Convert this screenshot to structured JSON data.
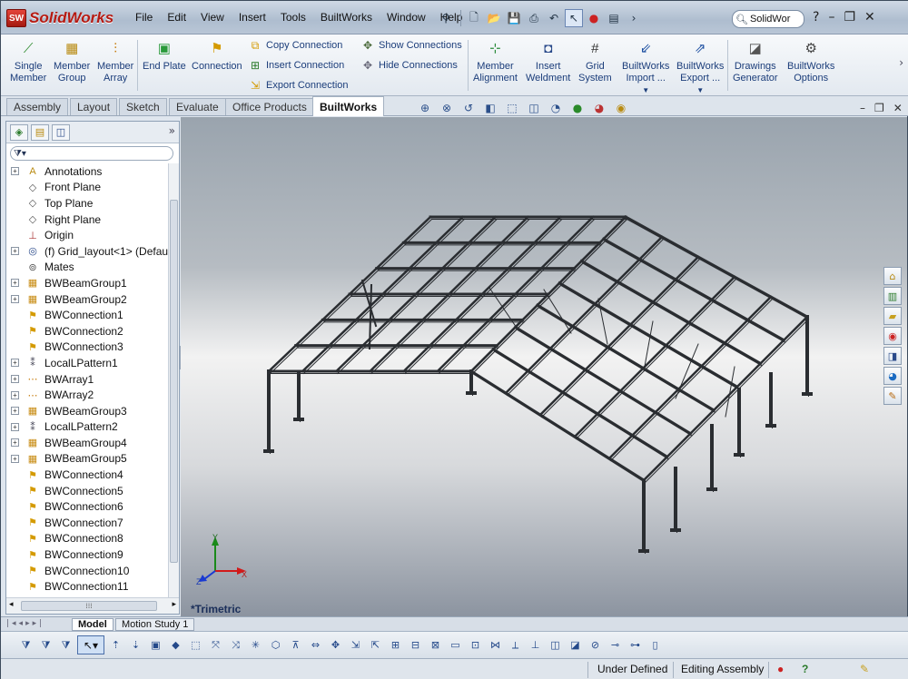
{
  "app": {
    "logo_badge": "SW",
    "name": "SolidWorks"
  },
  "menu": [
    "File",
    "Edit",
    "View",
    "Insert",
    "Tools",
    "BuiltWorks",
    "Window",
    "Help"
  ],
  "search": {
    "value": "SolidWor"
  },
  "ribbon": {
    "single_member": [
      "Single",
      "Member"
    ],
    "member_group": [
      "Member",
      "Group"
    ],
    "member_array": [
      "Member",
      "Array"
    ],
    "end_plate": "End Plate",
    "connection": "Connection",
    "copy_connection": "Copy Connection",
    "insert_connection": "Insert Connection",
    "export_connection": "Export Connection",
    "show_connections": "Show Connections",
    "hide_connections": "Hide Connections",
    "member_alignment": [
      "Member",
      "Alignment"
    ],
    "insert_weldment": [
      "Insert",
      "Weldment"
    ],
    "grid_system": [
      "Grid",
      "System"
    ],
    "bw_import": [
      "BuiltWorks",
      "Import ..."
    ],
    "bw_export": [
      "BuiltWorks",
      "Export ..."
    ],
    "drawings_generator": [
      "Drawings",
      "Generator"
    ],
    "bw_options": [
      "BuiltWorks",
      "Options"
    ]
  },
  "tabs": [
    "Assembly",
    "Layout",
    "Sketch",
    "Evaluate",
    "Office Products",
    "BuiltWorks"
  ],
  "active_tab": "BuiltWorks",
  "tree": [
    {
      "label": "Annotations",
      "icon": "annotations-icon",
      "expand": true
    },
    {
      "label": "Front Plane",
      "icon": "plane-icon",
      "expand": false
    },
    {
      "label": "Top Plane",
      "icon": "plane-icon",
      "expand": false
    },
    {
      "label": "Right Plane",
      "icon": "plane-icon",
      "expand": false
    },
    {
      "label": "Origin",
      "icon": "origin-icon",
      "expand": false
    },
    {
      "label": "(f) Grid_layout<1> (Defaul",
      "icon": "part-icon",
      "expand": true
    },
    {
      "label": "Mates",
      "icon": "mates-icon",
      "expand": false
    },
    {
      "label": "BWBeamGroup1",
      "icon": "beam-group-icon",
      "expand": true
    },
    {
      "label": "BWBeamGroup2",
      "icon": "beam-group-icon",
      "expand": true
    },
    {
      "label": "BWConnection1",
      "icon": "connection-icon",
      "expand": false
    },
    {
      "label": "BWConnection2",
      "icon": "connection-icon",
      "expand": false
    },
    {
      "label": "BWConnection3",
      "icon": "connection-icon",
      "expand": false
    },
    {
      "label": "LocalLPattern1",
      "icon": "pattern-icon",
      "expand": true
    },
    {
      "label": "BWArray1",
      "icon": "array-icon",
      "expand": true
    },
    {
      "label": "BWArray2",
      "icon": "array-icon",
      "expand": true
    },
    {
      "label": "BWBeamGroup3",
      "icon": "beam-group-icon",
      "expand": true
    },
    {
      "label": "LocalLPattern2",
      "icon": "pattern-icon",
      "expand": true
    },
    {
      "label": "BWBeamGroup4",
      "icon": "beam-group-icon",
      "expand": true
    },
    {
      "label": "BWBeamGroup5",
      "icon": "beam-group-icon",
      "expand": true
    },
    {
      "label": "BWConnection4",
      "icon": "connection-icon",
      "expand": false
    },
    {
      "label": "BWConnection5",
      "icon": "connection-icon",
      "expand": false
    },
    {
      "label": "BWConnection6",
      "icon": "connection-icon",
      "expand": false
    },
    {
      "label": "BWConnection7",
      "icon": "connection-icon",
      "expand": false
    },
    {
      "label": "BWConnection8",
      "icon": "connection-icon",
      "expand": false
    },
    {
      "label": "BWConnection9",
      "icon": "connection-icon",
      "expand": false
    },
    {
      "label": "BWConnection10",
      "icon": "connection-icon",
      "expand": false
    },
    {
      "label": "BWConnection11",
      "icon": "connection-icon",
      "expand": false
    }
  ],
  "viewport": {
    "view_label": "*Trimetric",
    "triad": {
      "x": "X",
      "y": "Y",
      "z": "Z"
    }
  },
  "bottom_tabs": [
    "Model",
    "Motion Study 1"
  ],
  "status": {
    "left": "Under Defined",
    "right": "Editing Assembly"
  },
  "colors": {
    "accent": "#b51a12",
    "ribbon_text": "#1b3d7a",
    "frame_steel": "#2a2d31"
  }
}
